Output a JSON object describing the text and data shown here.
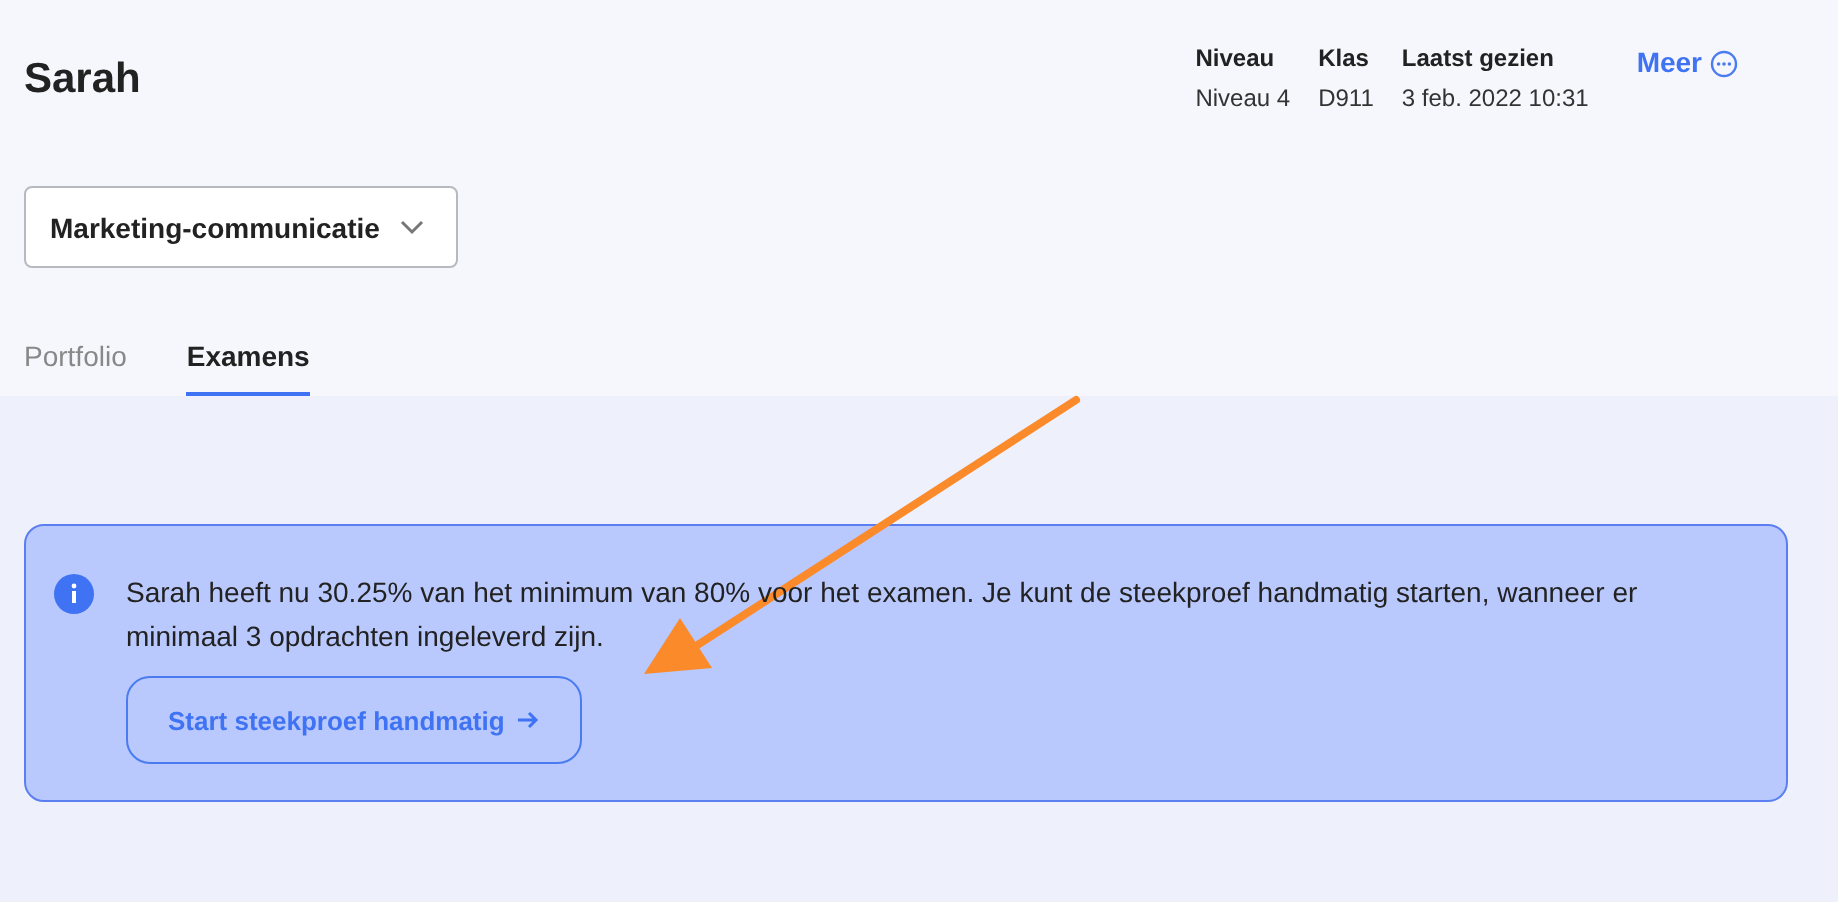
{
  "student": {
    "name": "Sarah"
  },
  "meta": [
    {
      "label": "Niveau",
      "value": "Niveau 4"
    },
    {
      "label": "Klas",
      "value": "D911"
    },
    {
      "label": "Laatst gezien",
      "value": "3 feb. 2022 10:31"
    }
  ],
  "more_link": {
    "label": "Meer"
  },
  "course_dropdown": {
    "value": "Marketing-communicatie"
  },
  "tabs": [
    {
      "label": "Portfolio",
      "selected": false
    },
    {
      "label": "Examens",
      "selected": true
    }
  ],
  "info_alert": {
    "message": "Sarah heeft nu 30.25% van het minimum van 80% voor het examen. Je kunt de steekproef handmatig starten, wanneer er minimaal 3 opdrachten ingeleverd zijn.",
    "button": "Start steekproef handmatig"
  }
}
